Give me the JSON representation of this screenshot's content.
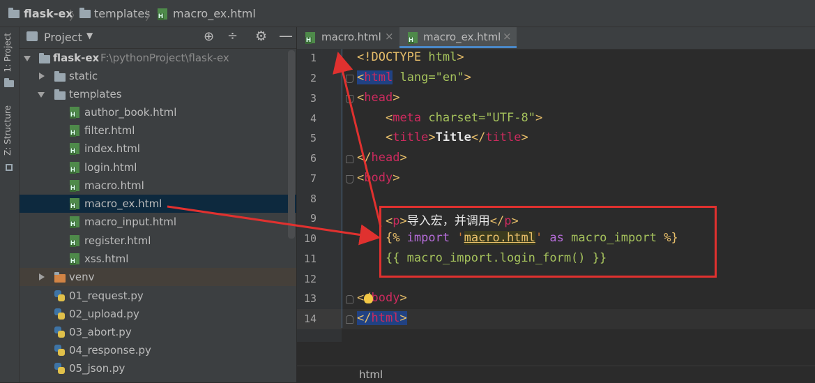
{
  "breadcrumb": {
    "project": "flask-ex",
    "folder": "templates",
    "file": "macro_ex.html"
  },
  "sidebar_tabs": {
    "project": "1: Project",
    "structure": "Z: Structure"
  },
  "project_panel": {
    "title": "Project",
    "root_name": "flask-ex",
    "root_path": "F:\\pythonProject\\flask-ex",
    "items": [
      {
        "label": "static"
      },
      {
        "label": "templates"
      },
      {
        "label": "author_book.html"
      },
      {
        "label": "filter.html"
      },
      {
        "label": "index.html"
      },
      {
        "label": "login.html"
      },
      {
        "label": "macro.html"
      },
      {
        "label": "macro_ex.html"
      },
      {
        "label": "macro_input.html"
      },
      {
        "label": "register.html"
      },
      {
        "label": "xss.html"
      },
      {
        "label": "venv"
      },
      {
        "label": "01_request.py"
      },
      {
        "label": "02_upload.py"
      },
      {
        "label": "03_abort.py"
      },
      {
        "label": "04_response.py"
      },
      {
        "label": "05_json.py"
      }
    ]
  },
  "editor": {
    "tabs": [
      {
        "label": "macro.html",
        "close": "×"
      },
      {
        "label": "macro_ex.html",
        "close": "×"
      }
    ],
    "line_numbers": [
      "1",
      "2",
      "3",
      "4",
      "5",
      "6",
      "7",
      "8",
      "9",
      "10",
      "11",
      "12",
      "13",
      "14"
    ],
    "code": {
      "l1_a": "<!DOCTYPE ",
      "l1_b": "html",
      "l1_c": ">",
      "l2_tag": "html",
      "l2_attr": "lang",
      "l2_val": "\"en\"",
      "l3_tag": "head",
      "l4_tag": "meta",
      "l4_attr": "charset",
      "l4_val": "\"UTF-8\"",
      "l5_tag": "title",
      "l5_text": "Title",
      "l6_tag": "head",
      "l7_tag": "body",
      "l9_tag": "p",
      "l9_text": "导入宏，并调用",
      "l10_open": "{% ",
      "l10_import": "import",
      "l10_q1": " '",
      "l10_file": "macro.html",
      "l10_q2": "' ",
      "l10_as": "as",
      "l10_name": " macro_import ",
      "l10_close": "%}",
      "l11": "{{ macro_import.login_form() }}",
      "l13_tag": "body",
      "l14_tag": "html",
      "lt": "<",
      "gt": ">",
      "lts": "</",
      "eq": "="
    },
    "status_text": "html"
  }
}
